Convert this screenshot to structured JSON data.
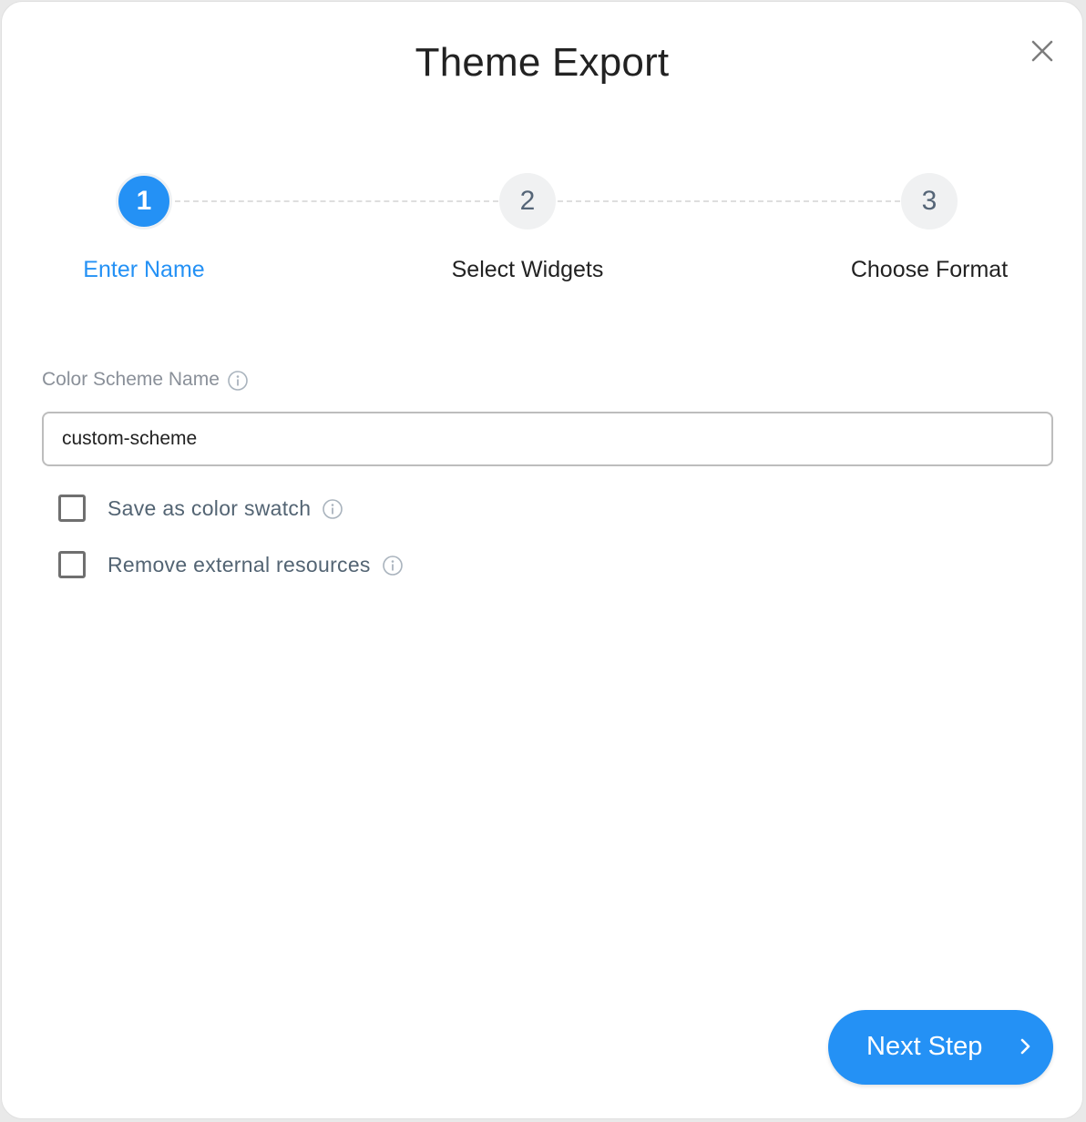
{
  "dialog": {
    "title": "Theme Export",
    "close_icon": "close-icon"
  },
  "stepper": {
    "current_step": 1,
    "steps": [
      {
        "number": "1",
        "label": "Enter Name",
        "active": true
      },
      {
        "number": "2",
        "label": "Select Widgets",
        "active": false
      },
      {
        "number": "3",
        "label": "Choose Format",
        "active": false
      }
    ]
  },
  "form": {
    "name_field": {
      "label": "Color Scheme Name",
      "value": "custom-scheme",
      "info_icon": "info-icon"
    },
    "checkboxes": [
      {
        "label": "Save as color swatch",
        "checked": false,
        "info_icon": "info-icon"
      },
      {
        "label": "Remove external resources",
        "checked": false,
        "info_icon": "info-icon"
      }
    ]
  },
  "footer": {
    "next_label": "Next Step",
    "next_icon": "chevron-right-icon"
  },
  "colors": {
    "accent": "#2491f5",
    "step_inactive_bg": "#f0f1f2",
    "step_inactive_text": "#556577",
    "label_muted": "#8a9099",
    "checkbox_label": "#536473"
  }
}
